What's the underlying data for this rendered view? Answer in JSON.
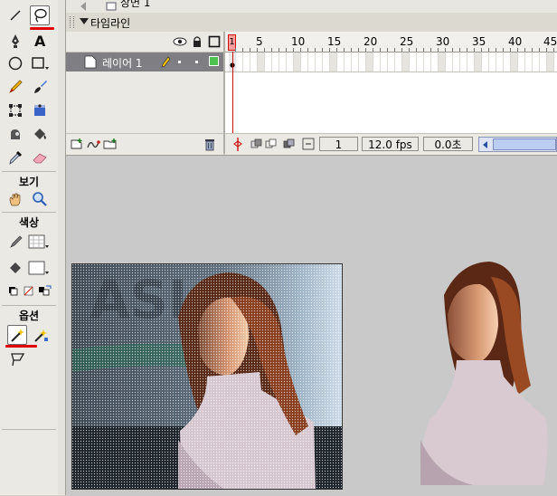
{
  "top_bar": {
    "scene_label": "장면 1"
  },
  "toolbox": {
    "view_label": "보기",
    "colors_label": "색상",
    "options_label": "옵션"
  },
  "timeline": {
    "title": "타임라인",
    "ruler_numbers": [
      "1",
      "5",
      "10",
      "15",
      "20",
      "25",
      "30",
      "35",
      "40",
      "45"
    ],
    "layer_name": "레이어 1",
    "current_frame": "1",
    "frame_rate": "12.0 fps",
    "elapsed_time": "0.0초"
  },
  "colors": {
    "accent_red": "#e00000",
    "layer_selected": "#7e7e83",
    "playhead": "#ff9c9c",
    "stage": "#c9c9c9"
  }
}
